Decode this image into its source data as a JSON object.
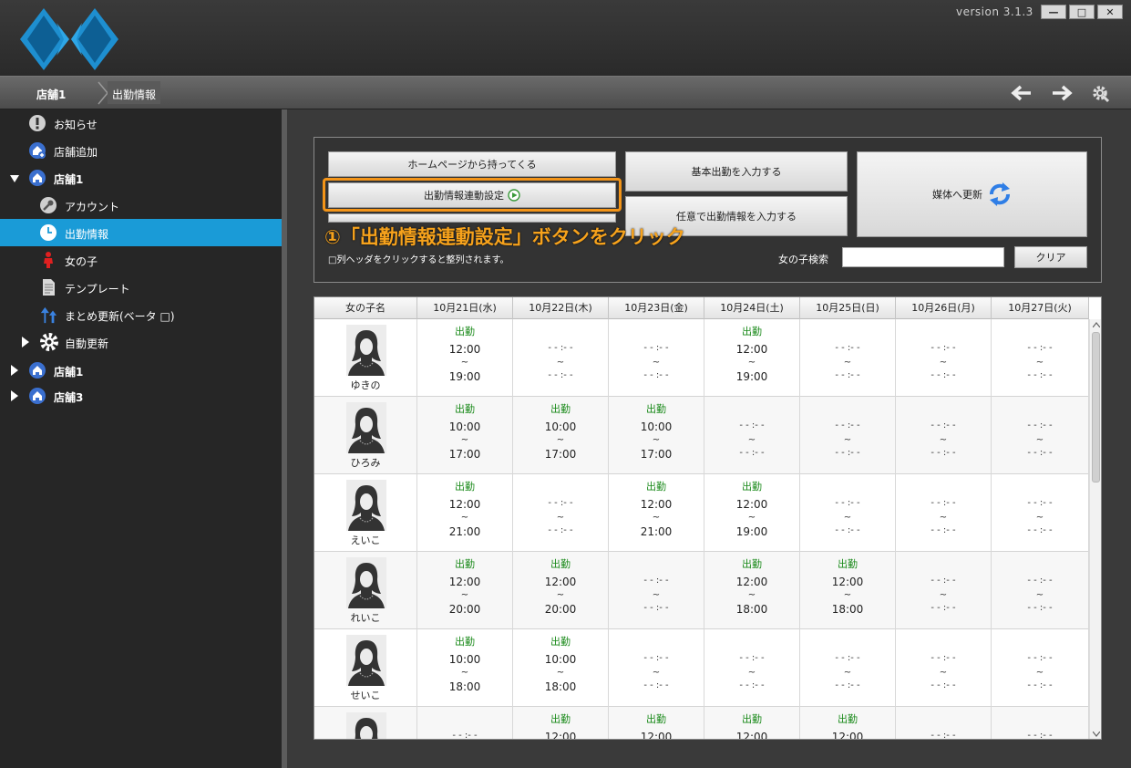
{
  "app": {
    "version": "version 3.1.3",
    "window_controls": {
      "minimize": "—",
      "maximize": "□",
      "close": "✕"
    }
  },
  "breadcrumb": {
    "items": [
      "店舗1",
      "出勤情報"
    ]
  },
  "sidebar": {
    "items": [
      {
        "label": "お知らせ",
        "icon": "exclamation-icon"
      },
      {
        "label": "店舗追加",
        "icon": "home-add-icon"
      },
      {
        "label": "店舗1",
        "icon": "home-icon"
      },
      {
        "label": "アカウント",
        "icon": "key-icon"
      },
      {
        "label": "出勤情報",
        "icon": "clock-icon"
      },
      {
        "label": "女の子",
        "icon": "person-icon"
      },
      {
        "label": "テンプレート",
        "icon": "document-icon"
      },
      {
        "label": "まとめ更新(ベータ □)",
        "icon": "upload-arrows-icon"
      },
      {
        "label": "自動更新",
        "icon": "gear-icon"
      },
      {
        "label": "店舗1",
        "icon": "home-icon"
      },
      {
        "label": "店舗3",
        "icon": "home-icon"
      }
    ]
  },
  "toolbar": {
    "fetch_homepage": "ホームページから持ってくる",
    "link_settings": "出勤情報連動設定",
    "basic_input": "基本出勤を入力する",
    "free_input": "任意で出勤情報を入力する",
    "media_update": "媒体へ更新",
    "hint": "□列ヘッダをクリックすると整列されます。",
    "search_label": "女の子検索",
    "search_value": "",
    "clear": "クリア"
  },
  "annotation": "①「出勤情報連動設定」ボタンをクリック",
  "colors": {
    "accent": "#1a9bd7",
    "highlight": "#f39418",
    "shift_label": "#1a8a1a"
  },
  "table": {
    "headers": [
      "女の子名",
      "10月21日(水)",
      "10月22日(木)",
      "10月23日(金)",
      "10月24日(土)",
      "10月25日(日)",
      "10月26日(月)",
      "10月27日(火)"
    ],
    "shift_label": "出勤",
    "tilde": "~",
    "empty": "- - :- -",
    "rows": [
      {
        "name": "ゆきの",
        "shifts": [
          [
            "12:00",
            "19:00"
          ],
          null,
          null,
          [
            "12:00",
            "19:00"
          ],
          null,
          null,
          null
        ]
      },
      {
        "name": "ひろみ",
        "shifts": [
          [
            "10:00",
            "17:00"
          ],
          [
            "10:00",
            "17:00"
          ],
          [
            "10:00",
            "17:00"
          ],
          null,
          null,
          null,
          null
        ]
      },
      {
        "name": "えいこ",
        "shifts": [
          [
            "12:00",
            "21:00"
          ],
          null,
          [
            "12:00",
            "21:00"
          ],
          [
            "12:00",
            "19:00"
          ],
          null,
          null,
          null
        ]
      },
      {
        "name": "れいこ",
        "shifts": [
          [
            "12:00",
            "20:00"
          ],
          [
            "12:00",
            "20:00"
          ],
          null,
          [
            "12:00",
            "18:00"
          ],
          [
            "12:00",
            "18:00"
          ],
          null,
          null
        ]
      },
      {
        "name": "せいこ",
        "shifts": [
          [
            "10:00",
            "18:00"
          ],
          [
            "10:00",
            "18:00"
          ],
          null,
          null,
          null,
          null,
          null
        ]
      },
      {
        "name": "",
        "shifts": [
          null,
          [
            "12:00",
            ""
          ],
          [
            "12:00",
            ""
          ],
          [
            "12:00",
            ""
          ],
          [
            "12:00",
            ""
          ],
          null,
          null
        ]
      }
    ]
  }
}
